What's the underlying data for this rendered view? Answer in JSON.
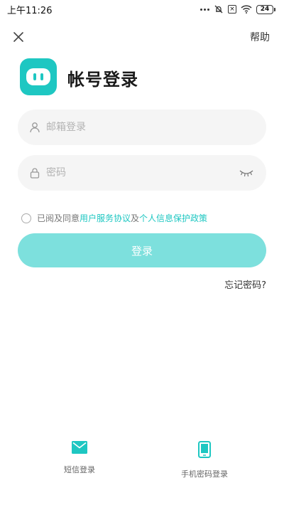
{
  "status_bar": {
    "time": "上午11:26",
    "battery": "24"
  },
  "header": {
    "help_label": "帮助"
  },
  "brand": {
    "title": "帐号登录",
    "accent_color": "#1ec7c2"
  },
  "form": {
    "email_placeholder": "邮箱登录",
    "password_placeholder": "密码",
    "agreement": {
      "prefix": "已阅及同意",
      "user_agreement": "用户服务协议",
      "joiner": "及",
      "privacy_policy": "个人信息保护政策"
    },
    "login_label": "登录",
    "forgot_label": "忘记密码?"
  },
  "alt_logins": [
    {
      "label": "短信登录",
      "icon": "envelope-icon"
    },
    {
      "label": "手机密码登录",
      "icon": "phone-icon"
    }
  ]
}
